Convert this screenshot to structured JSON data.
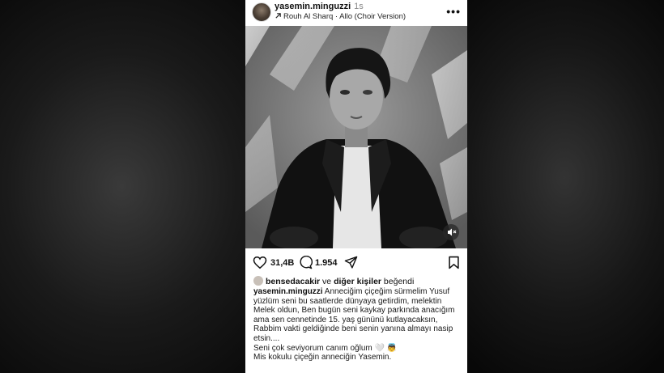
{
  "post": {
    "username": "yasemin.minguzzi",
    "time": "1s",
    "music": "Rouh Al Sharq · Allo (Choir Version)",
    "likes_count": "31,4B",
    "comments_count": "1.954",
    "liked_by_user": "bensedacakir",
    "liked_by_mid": " ve ",
    "liked_by_others": "diğer kişiler",
    "liked_by_suffix": " beğendi",
    "caption_user": "yasemin.minguzzi",
    "caption_text": " Anneciğim çiçeğim sürmelim Yusuf yüzlüm seni bu saatlerde dünyaya getirdim, melektin Melek oldun,  Ben bugün seni kaykay parkında anacığım ama sen cennetinde 15. yaş gününü kutlayacaksın, Rabbim vakti geldiğinde beni senin yanına almayı nasip etsin....",
    "caption_line2": "Seni çok seviyorum canım oğlum 🤍 👼",
    "caption_line3": "Mis kokulu çiçeğin anneciğin Yasemin."
  },
  "icons": [
    "more-icon",
    "arrow-icon",
    "heart-icon",
    "comment-icon",
    "share-icon",
    "bookmark-icon",
    "mute-icon"
  ]
}
